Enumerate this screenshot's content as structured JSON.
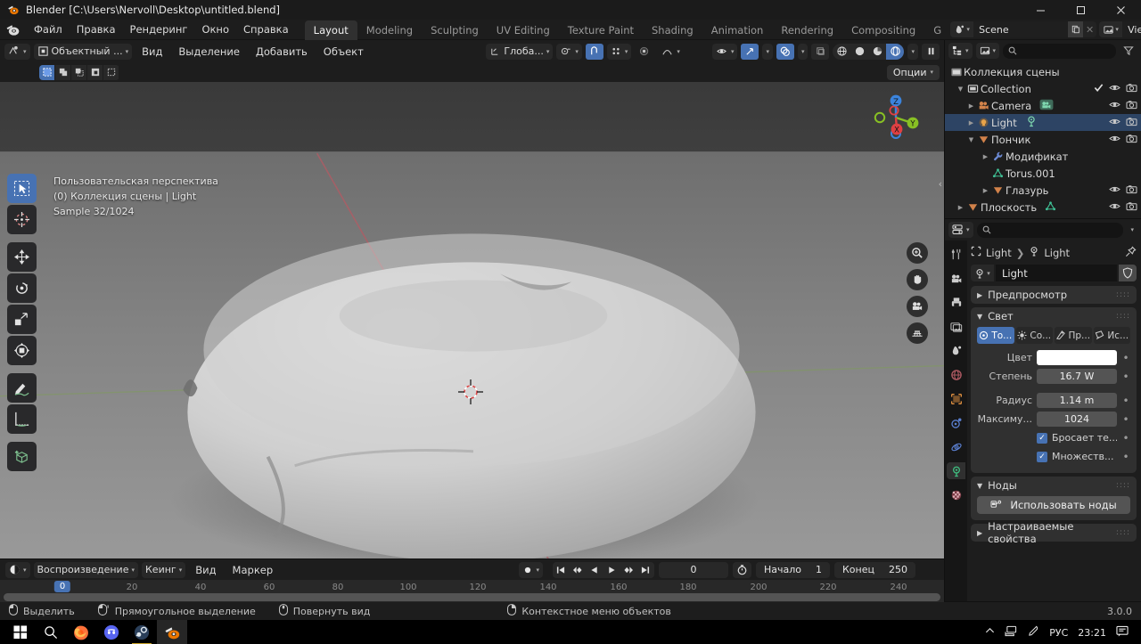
{
  "window": {
    "title": "Blender [C:\\Users\\Nervoll\\Desktop\\untitled.blend]",
    "minimize": "–",
    "maximize": "☐",
    "close": "✕"
  },
  "topbar": {
    "menus": [
      "Файл",
      "Правка",
      "Рендеринг",
      "Окно",
      "Справка"
    ],
    "tabs": [
      {
        "label": "Layout",
        "active": true
      },
      {
        "label": "Modeling",
        "active": false
      },
      {
        "label": "Sculpting",
        "active": false
      },
      {
        "label": "UV Editing",
        "active": false
      },
      {
        "label": "Texture Paint",
        "active": false
      },
      {
        "label": "Shading",
        "active": false
      },
      {
        "label": "Animation",
        "active": false
      },
      {
        "label": "Rendering",
        "active": false
      },
      {
        "label": "Compositing",
        "active": false
      },
      {
        "label": "G",
        "active": false
      }
    ],
    "scene_name": "Scene",
    "viewlayer_name": "ViewLayer"
  },
  "viewport_header": {
    "mode": "Объектный ...",
    "menus": [
      "Вид",
      "Выделение",
      "Добавить",
      "Объект"
    ],
    "transform_orientation": "Глоба...",
    "options_label": "Опции"
  },
  "viewport": {
    "overlay_line1": "Пользовательская перспектива",
    "overlay_line2": "(0) Коллекция сцены | Light",
    "overlay_line3": "Sample 32/1024",
    "gizmo_axes": [
      "Z",
      "Y",
      "X"
    ],
    "axis_colors": {
      "x": "#e04043",
      "y": "#88c024",
      "z": "#3b84dd"
    },
    "tools": [
      "tool-select-box",
      "tool-cursor",
      "tool-move",
      "tool-rotate",
      "tool-scale",
      "tool-transform",
      "tool-annotate",
      "tool-measure",
      "tool-add-cube"
    ],
    "nav_buttons": [
      "zoom-icon",
      "hand-icon",
      "camera-icon",
      "grid-icon"
    ]
  },
  "timeline": {
    "menus": [
      "Воспроизведение",
      "Кеинг",
      "Вид",
      "Маркер"
    ],
    "current_frame": "0",
    "start_label": "Начало",
    "start_value": "1",
    "end_label": "Конец",
    "end_value": "250",
    "ticks": [
      "0",
      "20",
      "40",
      "60",
      "80",
      "100",
      "120",
      "140",
      "160",
      "180",
      "200",
      "220",
      "240"
    ],
    "playhead": "0"
  },
  "outliner": {
    "search_placeholder": "",
    "rows": [
      {
        "label": "Коллекция сцены",
        "indent": 0,
        "icon": "scene-collection-icon",
        "disclosure": "",
        "selected": false,
        "tail": []
      },
      {
        "label": "Collection",
        "indent": 1,
        "icon": "collection-icon",
        "disclosure": "down",
        "selected": false,
        "tail": [
          "check",
          "eye",
          "camera"
        ]
      },
      {
        "label": "Camera",
        "indent": 2,
        "icon": "camera-object-icon",
        "disclosure": "right",
        "selected": false,
        "tail": [
          "eye",
          "camera"
        ],
        "badge": "camera-data-icon"
      },
      {
        "label": "Light",
        "indent": 2,
        "icon": "light-object-icon",
        "disclosure": "right",
        "selected": true,
        "tail": [
          "eye",
          "camera"
        ],
        "badge": "light-data-icon"
      },
      {
        "label": "Пончик",
        "indent": 2,
        "icon": "mesh-object-icon",
        "disclosure": "down",
        "selected": false,
        "tail": [
          "eye",
          "camera"
        ]
      },
      {
        "label": "Модификат",
        "indent": 3,
        "icon": "wrench-icon",
        "disclosure": "right",
        "selected": false,
        "tail": []
      },
      {
        "label": "Torus.001",
        "indent": 3,
        "icon": "mesh-data-icon",
        "disclosure": "",
        "selected": false,
        "tail": []
      },
      {
        "label": "Глазурь",
        "indent": 3,
        "icon": "mesh-object-icon",
        "disclosure": "right",
        "selected": false,
        "tail": [
          "eye",
          "camera"
        ]
      },
      {
        "label": "Плоскость",
        "indent": 1,
        "icon": "mesh-object-icon",
        "disclosure": "right",
        "selected": false,
        "tail": [
          "eye",
          "camera"
        ],
        "badge": "mesh-data-icon"
      }
    ]
  },
  "properties": {
    "breadcrumb_object": "Light",
    "breadcrumb_data": "Light",
    "id_name": "Light",
    "panels": {
      "preview": "Предпросмотр",
      "light": "Свет",
      "nodes": "Ноды",
      "custom_props": "Настраиваемые свойства"
    },
    "light_types": [
      {
        "label": "То...",
        "active": true
      },
      {
        "label": "Со...",
        "active": false
      },
      {
        "label": "Пр...",
        "active": false
      },
      {
        "label": "Ис...",
        "active": false
      }
    ],
    "fields": [
      {
        "label": "Цвет",
        "value": "",
        "white": true
      },
      {
        "label": "Степень",
        "value": "16.7 W",
        "white": false
      }
    ],
    "fields2": [
      {
        "label": "Радиус",
        "value": "1.14 m",
        "white": false
      },
      {
        "label": "Максиму...",
        "value": "1024",
        "white": false
      }
    ],
    "checkboxes": [
      {
        "label": "Бросает те...",
        "checked": true
      },
      {
        "label": "Множеств...",
        "checked": true
      }
    ],
    "use_nodes_label": "Использовать ноды",
    "tabs": [
      "tool-tab",
      "render-tab",
      "output-tab",
      "viewlayer-tab",
      "scene-tab",
      "world-tab",
      "object-tab",
      "modifier-tab",
      "physics-tab",
      "data-tab",
      "material-tab"
    ]
  },
  "statusbar": {
    "items": [
      {
        "icon": "mouse-left-icon",
        "label": "Выделить"
      },
      {
        "icon": "mouse-drag-icon",
        "label": "Прямоугольное выделение"
      },
      {
        "icon": "mouse-middle-icon",
        "label": "Повернуть вид"
      },
      {
        "icon": "mouse-right-icon",
        "label": "Контекстное меню объектов"
      }
    ],
    "version": "3.0.0"
  },
  "taskbar": {
    "icons": [
      "start-icon",
      "search-icon",
      "firefox-icon",
      "discord-icon",
      "steam-icon",
      "blender-icon"
    ],
    "tray": [
      "chevron-up-icon",
      "network-icon",
      "pen-icon"
    ],
    "language": "РУС",
    "clock": "23:21",
    "notification": "notification-icon"
  }
}
